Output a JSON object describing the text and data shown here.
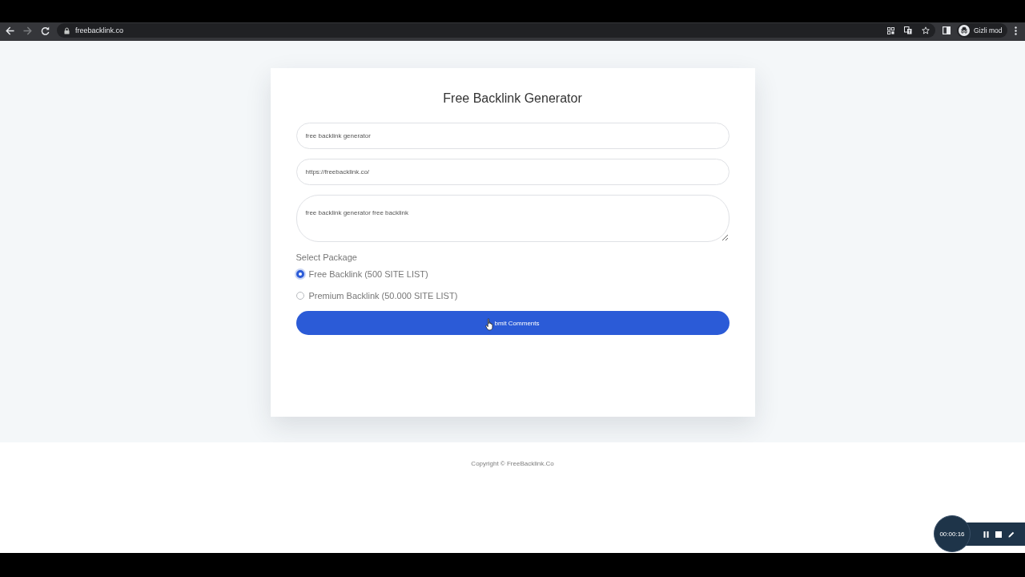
{
  "browser": {
    "forward_disabled": true,
    "url": "freebacklink.co",
    "profile_label": "Gizli mod"
  },
  "form": {
    "title": "Free Backlink Generator",
    "fields": [
      {
        "kind": "input",
        "value": "free backlink generator"
      },
      {
        "kind": "input",
        "value": "https://freebacklink.co/"
      },
      {
        "kind": "textarea",
        "value": "free backlink generator free backlink"
      }
    ],
    "package_label": "Select Package",
    "packages": [
      {
        "label": "Free Backlink (500 SITE LIST)",
        "selected": true
      },
      {
        "label": "Premium Backlink (50.000 SITE LIST)",
        "selected": false
      }
    ],
    "submit_button": "bmit Comments"
  },
  "footer": {
    "copyright": "Copyright © FreeBacklink.Co"
  },
  "recorder": {
    "elapsed": "00:00:16"
  }
}
